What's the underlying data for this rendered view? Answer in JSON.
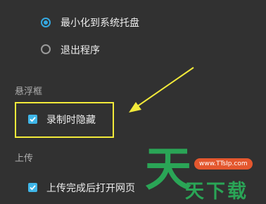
{
  "close_options": {
    "minimize_label": "最小化到系统托盘",
    "minimize_selected": true,
    "exit_label": "退出程序",
    "exit_selected": false
  },
  "floating_window": {
    "heading": "悬浮框",
    "hide_while_recording_label": "录制时隐藏",
    "hide_while_recording_checked": true
  },
  "upload": {
    "heading": "上传",
    "open_page_after_upload_label": "上传完成后打开网页",
    "open_page_after_upload_checked": true
  },
  "annotation": {
    "highlight_color": "#f2ea3a"
  },
  "watermark": {
    "site": "www.TTsIp.com",
    "logo_glyph": "天",
    "text": "天下载"
  },
  "colors": {
    "accent": "#35a8e0",
    "background": "#313131"
  }
}
